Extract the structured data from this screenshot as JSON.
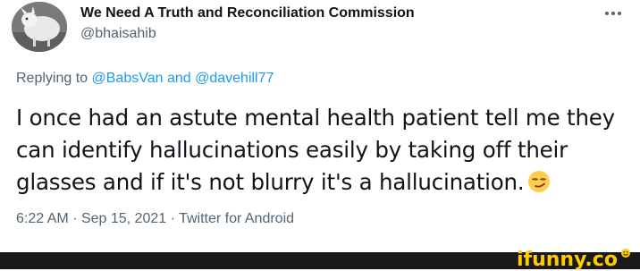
{
  "tweet": {
    "display_name": "We Need A Truth and Reconciliation Commission",
    "handle": "@bhaisahib",
    "more_icon": "more-horizontal-icon",
    "replying": {
      "prefix": "Replying to",
      "mention_1": "@BabsVan",
      "conjunction": "and",
      "mention_2": "@davehill77"
    },
    "text_line_1": "I once had an astute mental health patient tell me they",
    "text_line_2": "can identify hallucinations easily by taking off their",
    "text_line_3": "glasses and if it's not blurry it's a hallucination.",
    "emoji": "smirking-face-emoji",
    "meta": {
      "time": "6:22 AM",
      "separator_1": "·",
      "date": "Sep 15, 2021",
      "separator_2": "·",
      "source": "Twitter for Android"
    }
  },
  "watermark": {
    "text": "ifunny.co",
    "color": "#ffcc00"
  },
  "colors": {
    "text_primary": "#0f1419",
    "text_secondary": "#536471",
    "link": "#1d9bf0",
    "bar": "#191919"
  }
}
